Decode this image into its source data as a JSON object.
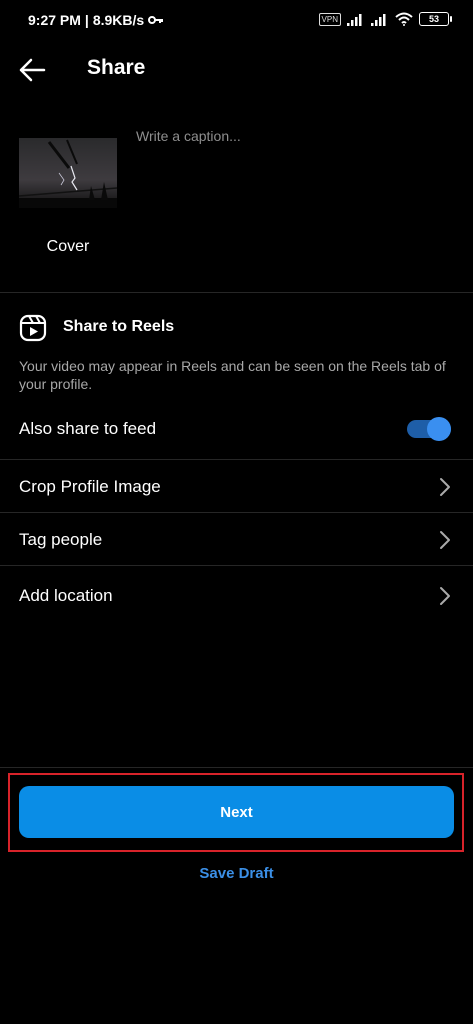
{
  "status_bar": {
    "time": "9:27 PM",
    "network_speed": "8.9KB/s",
    "vpn_label": "VPN",
    "battery_level": "53",
    "icons": [
      "key-icon",
      "signal-icon",
      "signal-icon",
      "wifi-icon",
      "battery-icon"
    ]
  },
  "header": {
    "title": "Share",
    "back_icon": "arrow-left-icon"
  },
  "post": {
    "caption_placeholder": "Write a caption...",
    "caption_value": "",
    "cover_label": "Cover"
  },
  "reels": {
    "title": "Share to Reels",
    "description": "Your video may appear in Reels and can be seen on the Reels tab of your profile.",
    "icon": "reels-icon"
  },
  "options": {
    "also_share_label": "Also share to feed",
    "also_share_enabled": true,
    "crop_label": "Crop Profile Image",
    "tag_label": "Tag people",
    "location_label": "Add location"
  },
  "actions": {
    "next_label": "Next",
    "save_draft_label": "Save Draft"
  },
  "colors": {
    "background": "#000000",
    "accent": "#0a8de6",
    "link": "#3b8fe6",
    "highlight_border": "#d8232a"
  }
}
